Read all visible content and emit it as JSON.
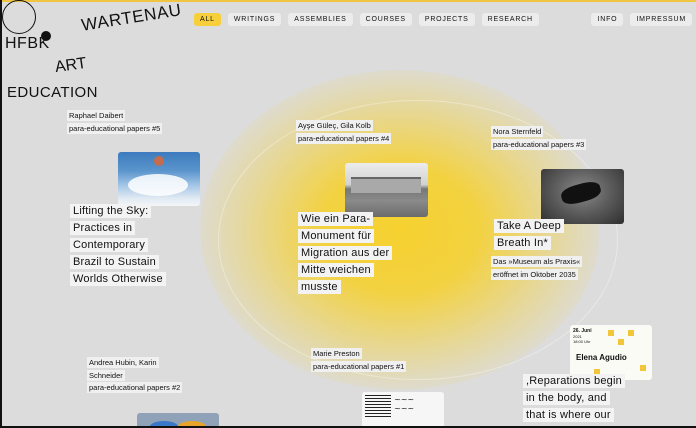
{
  "logo": {
    "hfbk": "HFBK",
    "wartenau": "WARTENAU",
    "art": "ART",
    "education": "EDUCATION"
  },
  "nav": {
    "items": [
      "ALL",
      "WRITINGS",
      "ASSEMBLIES",
      "COURSES",
      "PROJECTS",
      "RESEARCH"
    ],
    "active": "ALL",
    "right": [
      "INFO",
      "IMPRESSUM"
    ]
  },
  "colors": {
    "accent": "#f6cf3a",
    "glow": "#f7d026",
    "background": "#dcdcdc"
  },
  "cards": [
    {
      "authors": "Raphael Daibert",
      "series": "para-educational papers #5",
      "title": [
        "Lifting the Sky:",
        "Practices in",
        "Contemporary",
        "Brazil to Sustain",
        "Worlds Otherwise"
      ]
    },
    {
      "authors": "Ayşe Güleç, Gila Kolb",
      "series": "para-educational papers #4",
      "title": [
        "Wie ein Para-",
        "Monument für",
        "Migration aus der",
        "Mitte weichen",
        "musste"
      ]
    },
    {
      "authors": "Nora Sternfeld",
      "series": "para-educational papers #3",
      "title": [
        "Take A Deep",
        "Breath In*"
      ],
      "subtitle": [
        "Das »Museum als Praxis«",
        "eröffnet im Oktober 2035"
      ]
    },
    {
      "authors": [
        "Andrea Hubin, Karin",
        "Schneider"
      ],
      "series": "para-educational papers #2"
    },
    {
      "authors": "Marie Preston",
      "series": "para-educational papers #1"
    },
    {
      "poster": {
        "date_line1": "26. Juni",
        "date_line2": "2021",
        "date_line3": "18:00 Uhr",
        "name": "Elena Agudio"
      },
      "title": [
        ",Reparations begin",
        "in the body, and",
        "that is where our"
      ]
    }
  ]
}
